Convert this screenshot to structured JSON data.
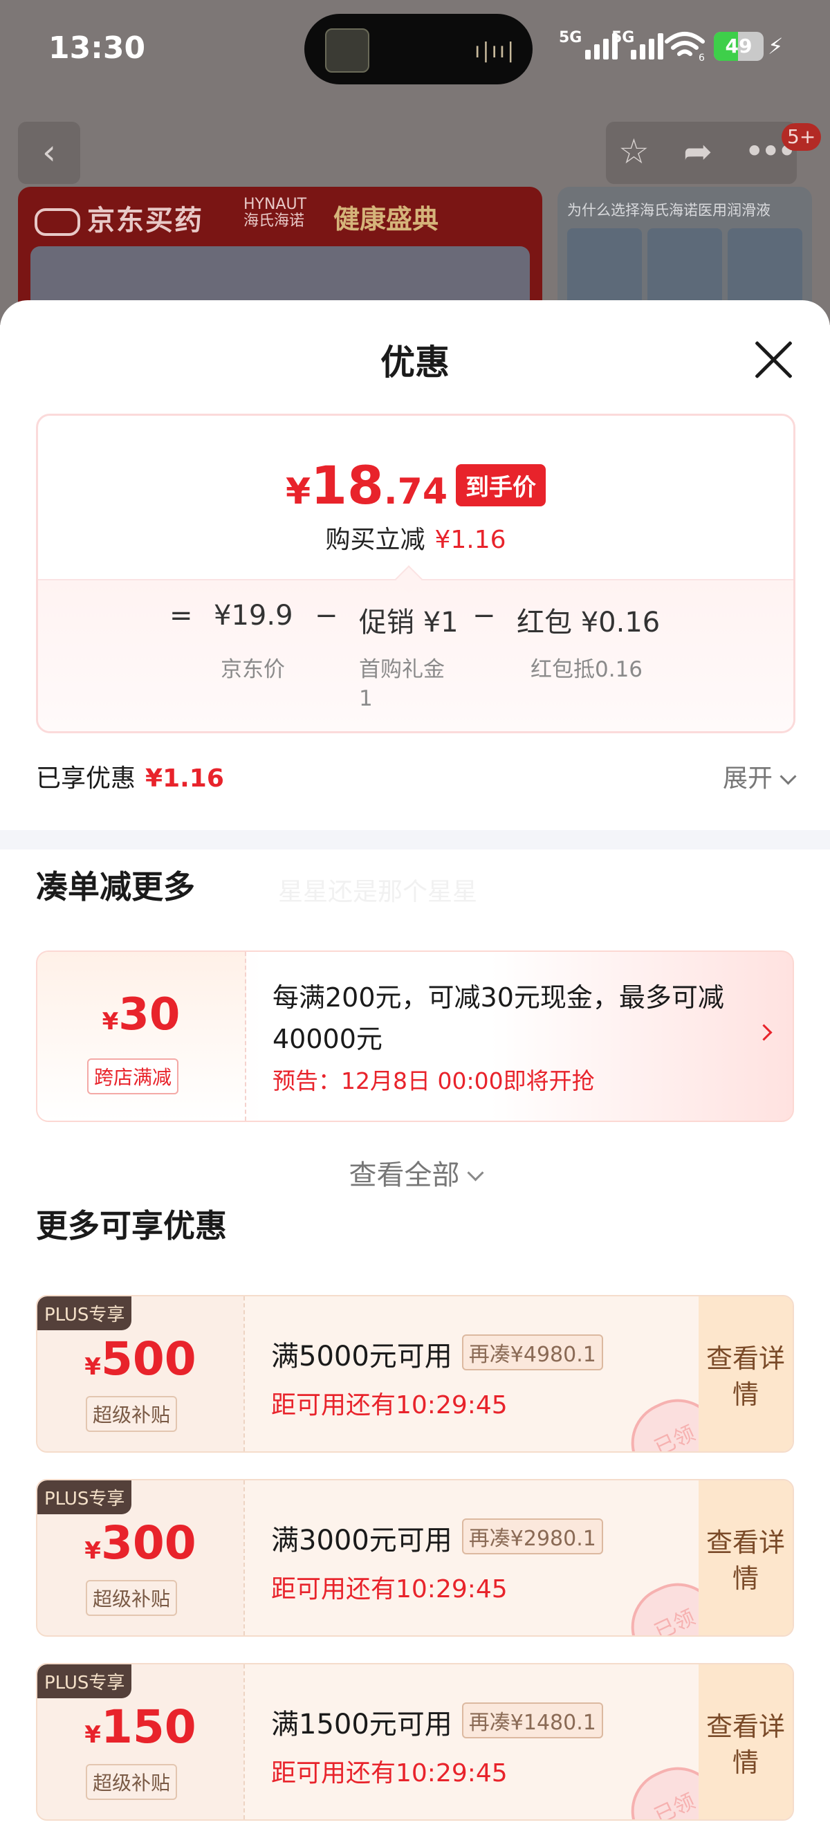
{
  "status_bar": {
    "time": "13:30",
    "signal_1": "5G",
    "signal_2": "5G",
    "wifi_label": "6",
    "battery": "49",
    "battery_level": 0.49,
    "wave_glyph": "ı|ıı|"
  },
  "background_page": {
    "back_icon": "chevron-left-icon",
    "icons": [
      "star-icon",
      "share-icon",
      "more-icon"
    ],
    "notification_badge": "5+",
    "banner_logo": "京东买药",
    "banner_brand_en": "HYNAUT",
    "banner_brand_cn": "海氏海诺",
    "banner_festival": "健康盛典",
    "side_banner_text": "为什么选择海氏海诺医用润滑液"
  },
  "sheet": {
    "title": "优惠",
    "close_icon": "close-icon"
  },
  "price_card": {
    "currency": "¥",
    "price_int": "18",
    "price_dec": ".74",
    "tag": "到手价",
    "reduce_label": "购买立减",
    "reduce_amount": "¥1.16",
    "breakdown": {
      "eq": "=",
      "jd_price": "¥19.9",
      "jd_price_label": "京东价",
      "minus1": "−",
      "promo": "促销 ¥1",
      "promo_label": "首购礼金\n1",
      "minus2": "−",
      "redpacket": "红包 ¥0.16",
      "redpacket_label": "红包抵0.16"
    }
  },
  "enjoyed": {
    "label": "已享优惠",
    "amount": "¥1.16",
    "expand_label": "展开"
  },
  "bundle_section": {
    "title": "凑单减更多",
    "watermark": "星星还是那个星星",
    "promo": {
      "currency": "¥",
      "amount": "30",
      "badge": "跨店满减",
      "desc": "每满200元，可减30元现金，最多可减40000元",
      "notice": "预告：12月8日 00:00即将开抢"
    },
    "view_all": "查看全部"
  },
  "more_section": {
    "title": "更多可享优惠",
    "coupons": [
      {
        "plus": "PLUS专享",
        "currency": "¥",
        "amount": "500",
        "tag": "超级补贴",
        "condition": "满5000元可用",
        "more": "再凑¥4980.1",
        "timer": "距可用还有10:29:45",
        "detail": "查看详情",
        "stamp": "已领"
      },
      {
        "plus": "PLUS专享",
        "currency": "¥",
        "amount": "300",
        "tag": "超级补贴",
        "condition": "满3000元可用",
        "more": "再凑¥2980.1",
        "timer": "距可用还有10:29:45",
        "detail": "查看详情",
        "stamp": "已领"
      },
      {
        "plus": "PLUS专享",
        "currency": "¥",
        "amount": "150",
        "tag": "超级补贴",
        "condition": "满1500元可用",
        "more": "再凑¥1480.1",
        "timer": "距可用还有10:29:45",
        "detail": "查看详情",
        "stamp": "已领"
      }
    ]
  },
  "colors": {
    "accent_red": "#e8232b",
    "plus_badge": "#54403a",
    "detail_bg": "#fde6cc"
  }
}
